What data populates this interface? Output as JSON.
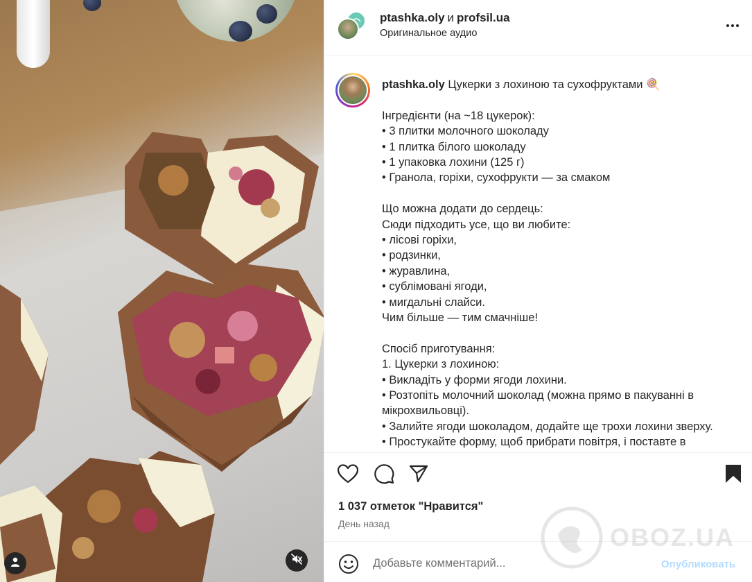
{
  "post": {
    "header": {
      "author": "ptashka.oly",
      "connector": "и",
      "coauthor": "profsil.ua",
      "audio": "Оригинальное аудио"
    },
    "caption": {
      "author": "ptashka.oly",
      "title": "Цукерки з лохиною та сухофруктами 🍭",
      "lines": [
        "",
        "Інгредієнти (на ~18 цукерок):",
        "• 3 плитки молочного шоколаду",
        "• 1 плитка білого шоколаду",
        "• 1 упаковка лохини (125 г)",
        "• Гранола, горіхи, сухофрукти — за смаком",
        "",
        "Що можна додати до сердець:",
        "Сюди підходить усе, що ви любите:",
        "• лісові горіхи,",
        "• родзинки,",
        "• журавлина,",
        "• сублімовані ягоди,",
        "• мигдальні слайси.",
        "Чим більше — тим смачніше!",
        "",
        "Спосіб приготування:",
        "1. Цукерки з лохиною:",
        "• Викладіть у форми ягоди лохини.",
        "• Розтопіть молочний шоколад (можна прямо в пакуванні в",
        "мікрохвильовці).",
        "• Залийте ягоди шоколадом, додайте ще трохи лохини зверху.",
        "• Простукайте форму, щоб прибрати повітря, і поставте в"
      ]
    },
    "likes": "1 037 отметок \"Нравится\"",
    "time": "День назад",
    "comment": {
      "placeholder": "Добавьте комментарий...",
      "publish": "Опубликовать"
    },
    "watermark": "OBOZ.UA",
    "icons": [
      "more-icon",
      "heart-icon",
      "comment-icon",
      "share-icon",
      "bookmark-icon",
      "emoji-icon",
      "user-icon",
      "mute-icon"
    ],
    "colors": {
      "publish": "#b3dbff",
      "secondary_text": "#737373",
      "border": "#efefef"
    }
  }
}
